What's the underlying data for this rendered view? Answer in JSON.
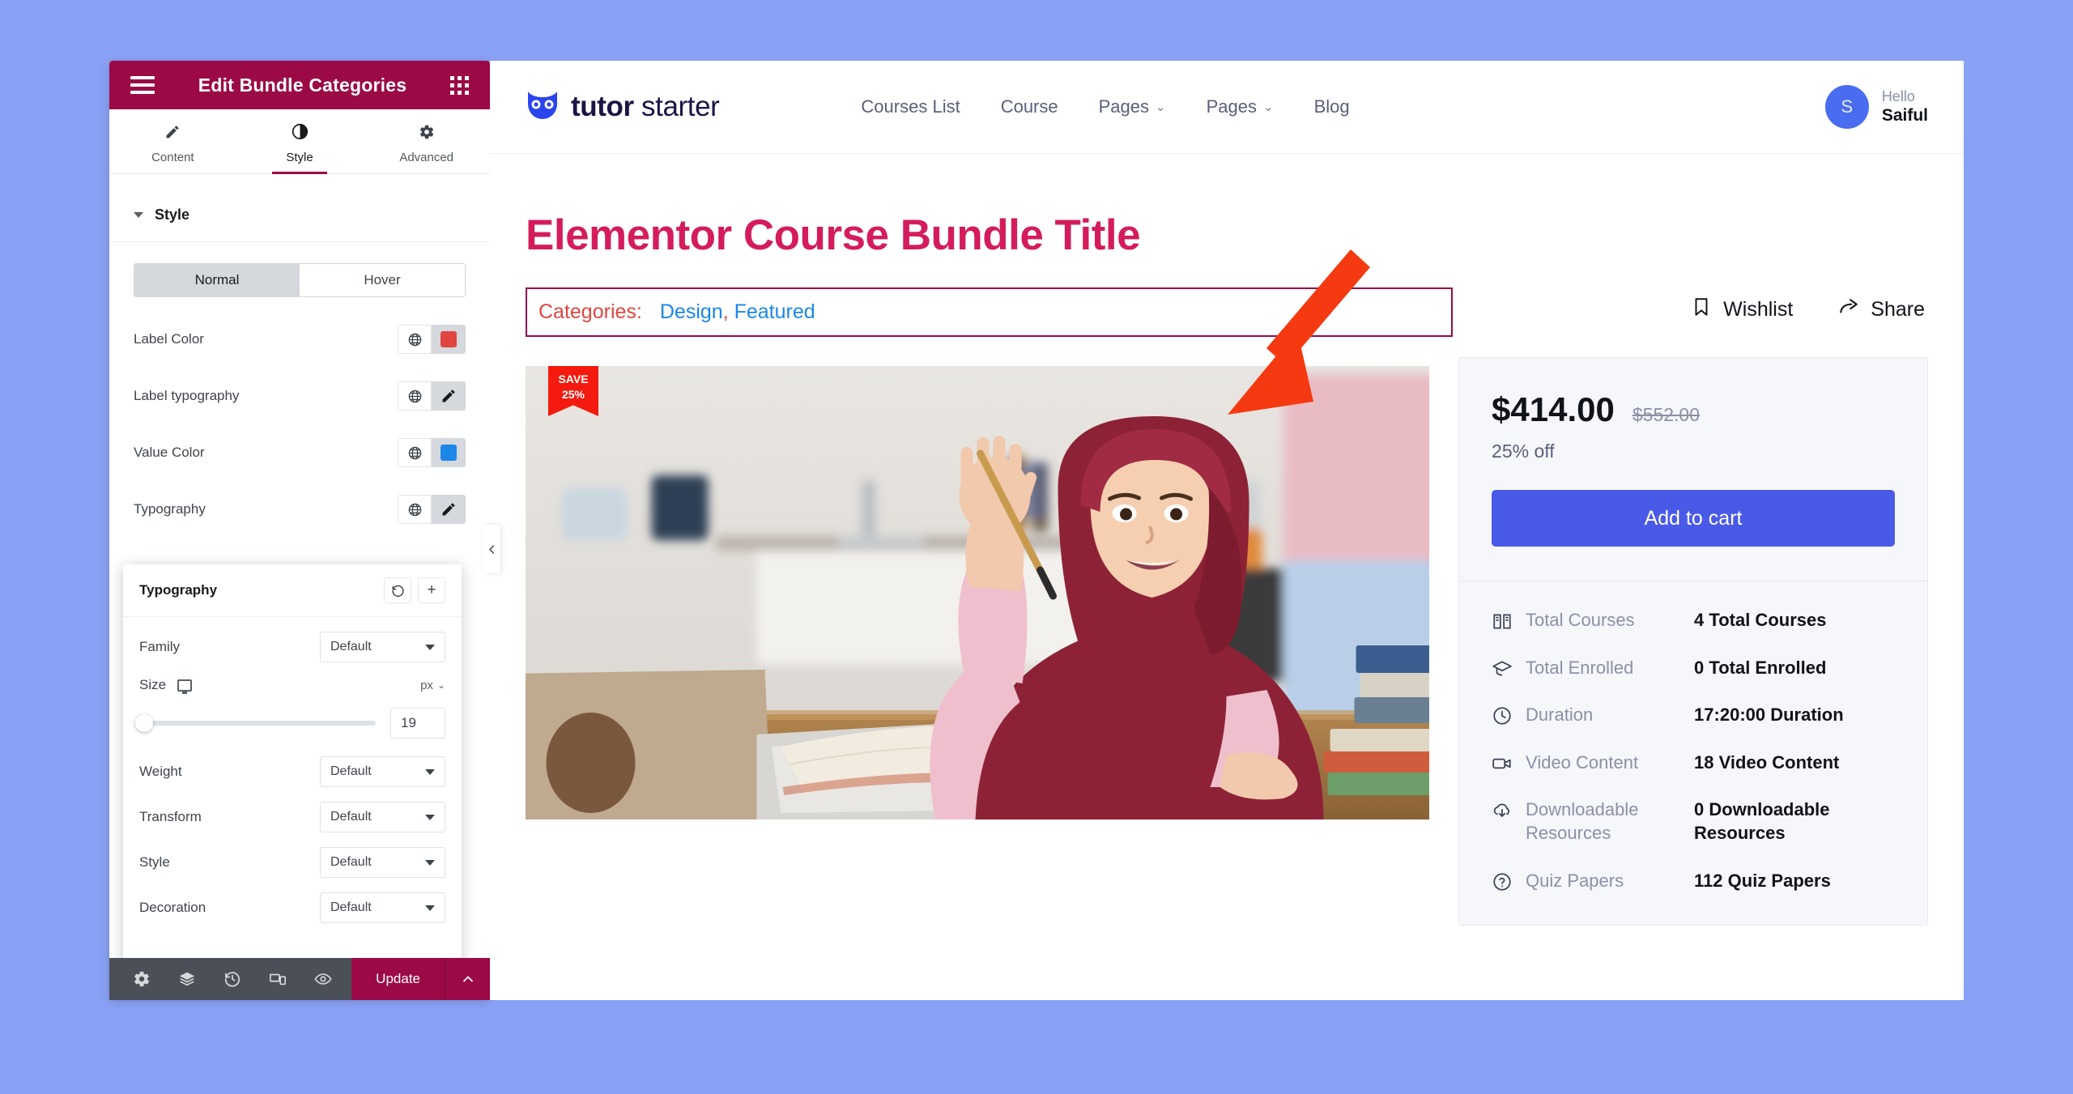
{
  "theme": {
    "page_bg": "#8aa2f5",
    "panel_header_bg": "#9b0a46",
    "accent_pink": "#d41c5c",
    "brand_blue": "#4a5ae8",
    "annotation_red": "#f53a11"
  },
  "panel": {
    "header": {
      "title": "Edit Bundle Categories",
      "menu_icon": "hamburger-icon",
      "apps_icon": "grid-apps-icon"
    },
    "tabs": [
      {
        "label": "Content",
        "icon": "pencil-icon",
        "active": false
      },
      {
        "label": "Style",
        "icon": "contrast-half-circle-icon",
        "active": true
      },
      {
        "label": "Advanced",
        "icon": "gear-icon",
        "active": false
      }
    ],
    "section": {
      "title": "Style"
    },
    "state_switch": {
      "normal": "Normal",
      "hover": "Hover",
      "selected": "Normal"
    },
    "controls": [
      {
        "label": "Label Color",
        "widget": "color",
        "value": "#e0453f",
        "globe_icon": "globe-icon"
      },
      {
        "label": "Label typography",
        "widget": "typography",
        "edit_icon": "pencil-icon",
        "globe_icon": "globe-icon"
      },
      {
        "label": "Value Color",
        "widget": "color",
        "value": "#1c87e8",
        "globe_icon": "globe-icon"
      },
      {
        "label": "Typography",
        "widget": "typography",
        "edit_icon": "pencil-icon",
        "globe_icon": "globe-icon"
      }
    ],
    "typography_popover": {
      "title": "Typography",
      "reset_icon": "reset-arrow-icon",
      "add_icon": "plus-icon",
      "fields": [
        {
          "label": "Family",
          "value": "Default",
          "type": "select"
        },
        {
          "label": "Size",
          "value": "19",
          "unit": "px",
          "type": "slider",
          "device_icon": "desktop-icon",
          "slider_percent": 2
        },
        {
          "label": "Weight",
          "value": "Default",
          "type": "select"
        },
        {
          "label": "Transform",
          "value": "Default",
          "type": "select"
        },
        {
          "label": "Style",
          "value": "Default",
          "type": "select"
        },
        {
          "label": "Decoration",
          "value": "Default",
          "type": "select"
        }
      ]
    },
    "footer": {
      "icons": [
        "gear-settings-icon",
        "layers-navigator-icon",
        "history-clock-icon",
        "responsive-devices-icon",
        "eye-preview-icon"
      ],
      "update_label": "Update",
      "chevron_icon": "chevron-up-icon"
    },
    "collapse_handle_icon": "chevron-left-icon"
  },
  "preview": {
    "header": {
      "logo_icon": "owl-logo-icon",
      "brand_bold": "tutor",
      "brand_light": " starter",
      "nav": [
        {
          "label": "Courses List",
          "has_caret": false
        },
        {
          "label": "Course",
          "has_caret": false
        },
        {
          "label": "Pages",
          "has_caret": true
        },
        {
          "label": "Pages",
          "has_caret": true
        },
        {
          "label": "Blog",
          "has_caret": false
        }
      ],
      "user": {
        "avatar_initial": "S",
        "greeting": "Hello",
        "name": "Saiful"
      }
    },
    "bundle": {
      "title": "Elementor Course Bundle Title",
      "categories_label": "Categories:",
      "categories_values": "Design, Featured",
      "category_items": [
        "Design",
        "Featured"
      ],
      "save_badge": {
        "line1": "SAVE",
        "line2": "25%"
      },
      "image_alt": "Girl in maroon hijab raising hand with pencil at laptop and open book"
    },
    "actions": [
      {
        "label": "Wishlist",
        "icon": "bookmark-icon"
      },
      {
        "label": "Share",
        "icon": "share-arrow-icon"
      }
    ],
    "price_card": {
      "price": "$414.00",
      "original_price": "$552.00",
      "discount": "25% off",
      "cart_button": "Add to cart"
    },
    "meta": [
      {
        "icon": "open-book-icon",
        "label": "Total Courses",
        "value": "4 Total Courses"
      },
      {
        "icon": "graduation-cap-icon",
        "label": "Total Enrolled",
        "value": "0 Total Enrolled"
      },
      {
        "icon": "clock-icon",
        "label": "Duration",
        "value": "17:20:00 Duration"
      },
      {
        "icon": "video-camera-icon",
        "label": "Video Content",
        "value": "18 Video Content"
      },
      {
        "icon": "cloud-download-icon",
        "label": "Downloadable Resources",
        "value": "0 Downloadable Resources"
      },
      {
        "icon": "question-circle-icon",
        "label": "Quiz Papers",
        "value": "112 Quiz Papers"
      }
    ]
  },
  "annotation": {
    "arrow_icon": "red-pointer-arrow-icon",
    "highlight_target": "Categories row"
  }
}
